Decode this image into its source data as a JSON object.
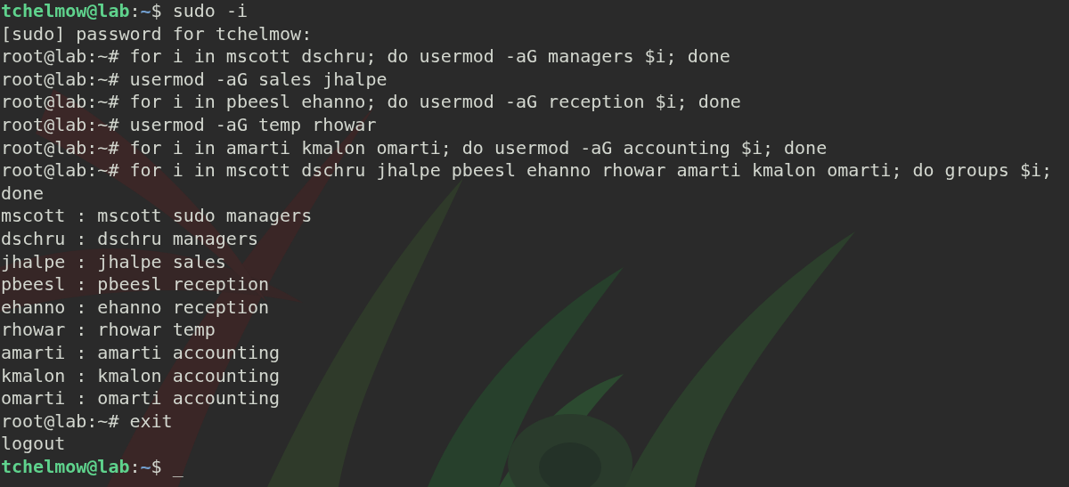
{
  "terminal": {
    "lines": [
      {
        "kind": "user_prompt",
        "user": "tchelmow@lab",
        "separator": ":",
        "path": "~",
        "symbol": "$ ",
        "command": "sudo -i"
      },
      {
        "kind": "output",
        "text": "[sudo] password for tchelmow:"
      },
      {
        "kind": "root_prompt",
        "prompt": "root@lab:~# ",
        "command": "for i in mscott dschru; do usermod -aG managers $i; done"
      },
      {
        "kind": "root_prompt",
        "prompt": "root@lab:~# ",
        "command": "usermod -aG sales jhalpe"
      },
      {
        "kind": "root_prompt",
        "prompt": "root@lab:~# ",
        "command": "for i in pbeesl ehanno; do usermod -aG reception $i; done"
      },
      {
        "kind": "root_prompt",
        "prompt": "root@lab:~# ",
        "command": "usermod -aG temp rhowar"
      },
      {
        "kind": "root_prompt",
        "prompt": "root@lab:~# ",
        "command": "for i in amarti kmalon omarti; do usermod -aG accounting $i; done"
      },
      {
        "kind": "root_prompt",
        "prompt": "root@lab:~# ",
        "command": "for i in mscott dschru jhalpe pbeesl ehanno rhowar amarti kmalon omarti; do groups $i; done"
      },
      {
        "kind": "output",
        "text": "mscott : mscott sudo managers"
      },
      {
        "kind": "output",
        "text": "dschru : dschru managers"
      },
      {
        "kind": "output",
        "text": "jhalpe : jhalpe sales"
      },
      {
        "kind": "output",
        "text": "pbeesl : pbeesl reception"
      },
      {
        "kind": "output",
        "text": "ehanno : ehanno reception"
      },
      {
        "kind": "output",
        "text": "rhowar : rhowar temp"
      },
      {
        "kind": "output",
        "text": "amarti : amarti accounting"
      },
      {
        "kind": "output",
        "text": "kmalon : kmalon accounting"
      },
      {
        "kind": "output",
        "text": "omarti : omarti accounting"
      },
      {
        "kind": "root_prompt",
        "prompt": "root@lab:~# ",
        "command": "exit"
      },
      {
        "kind": "output",
        "text": "logout"
      },
      {
        "kind": "user_prompt",
        "user": "tchelmow@lab",
        "separator": ":",
        "path": "~",
        "symbol": "$ ",
        "command": "_"
      }
    ]
  }
}
